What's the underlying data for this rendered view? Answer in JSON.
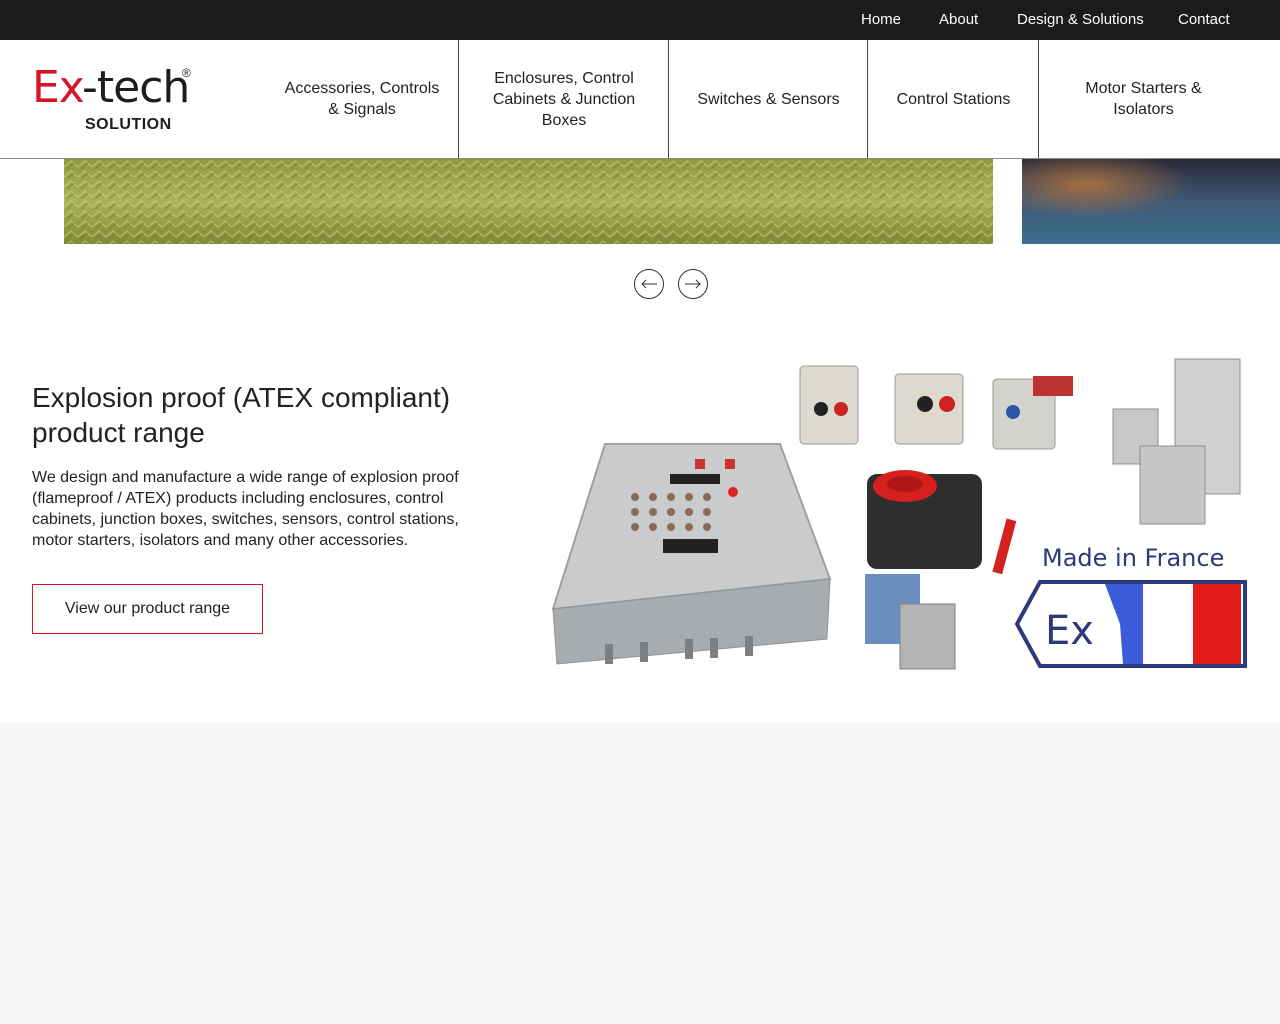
{
  "topnav": {
    "items": [
      "Home",
      "About",
      "Design & Solutions",
      "Contact"
    ]
  },
  "logo": {
    "brand_ex": "Ex",
    "brand_rest": "-tech",
    "registered": "®",
    "tagline": "SOLUTION"
  },
  "mainnav": {
    "items": [
      {
        "label": "Accessories, Controls & Signals"
      },
      {
        "label": "Enclosures, Control Cabinets & Junction Boxes"
      },
      {
        "label": "Switches & Sensors"
      },
      {
        "label": "Control Stations"
      },
      {
        "label": "Motor Starters & Isolators"
      }
    ]
  },
  "carousel": {
    "prev_icon": "arrow-left-icon",
    "next_icon": "arrow-right-icon"
  },
  "intro": {
    "title": "Explosion proof (ATEX compliant) product range",
    "body": "We design and manufacture a wide range of explosion proof (flameproof / ATEX) products including enclosures, control cabinets, junction boxes, switches, sensors, control stations, motor starters, isolators and many other accessories.",
    "cta_label": "View our product range"
  },
  "product_image": {
    "made_in": "Made in France",
    "ex_mark": "Ex"
  },
  "colors": {
    "accent": "#d4162a",
    "topbar_bg": "#1b1b1b",
    "french_blue": "#3b5bdb",
    "french_red": "#e21a1a"
  }
}
